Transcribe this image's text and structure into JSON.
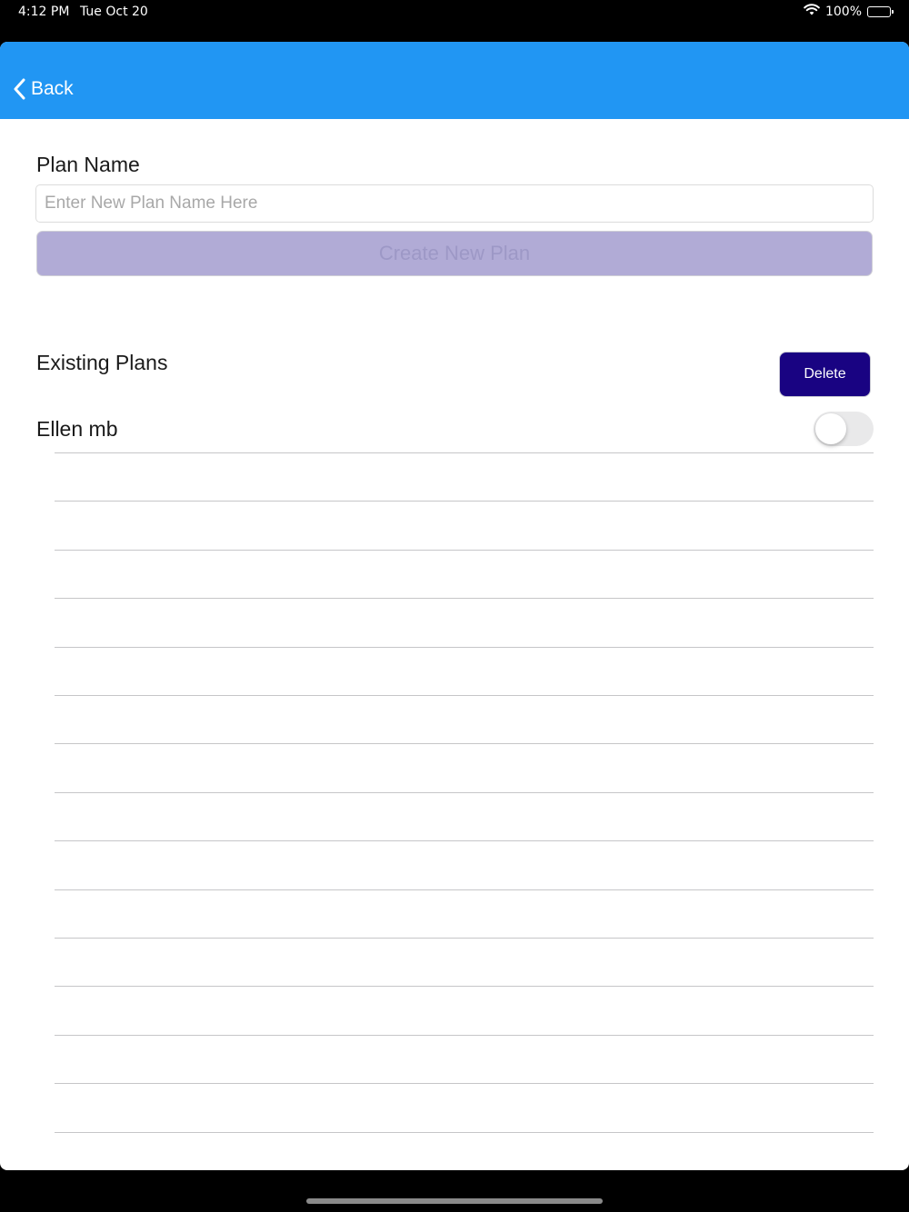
{
  "status_bar": {
    "time": "4:12 PM",
    "date": "Tue Oct 20",
    "battery": "100%",
    "icons": [
      "wifi-icon",
      "battery-icon"
    ]
  },
  "navbar": {
    "back_label": "Back",
    "color": "#2196F3"
  },
  "form": {
    "plan_name_label": "Plan Name",
    "plan_name_value": "",
    "plan_name_placeholder": "Enter New Plan Name Here",
    "create_button_label": "Create New Plan"
  },
  "existing": {
    "heading": "Existing Plans",
    "delete_label": "Delete",
    "plans": [
      {
        "name": "Ellen mb",
        "selected": false
      }
    ]
  },
  "colors": {
    "create_button": "#b1abd6",
    "delete_button": "#190382"
  }
}
